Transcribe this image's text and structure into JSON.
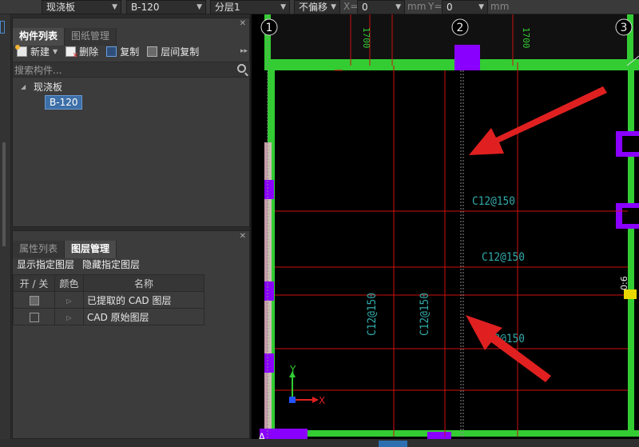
{
  "toolbar": {
    "type_combo": "现浇板",
    "name_combo": "B-120",
    "layer_combo": "分层1",
    "offset_combo": "不偏移",
    "x_label": "X=",
    "x_value": "0",
    "x_unit": "mm",
    "y_label": "Y=",
    "y_value": "0",
    "y_unit": "mm"
  },
  "component_panel": {
    "tabs": [
      "构件列表",
      "图纸管理"
    ],
    "buttons": {
      "new": "新建",
      "delete": "删除",
      "copy": "复制",
      "layer_copy": "层间复制"
    },
    "search_placeholder": "搜索构件...",
    "tree": {
      "parent": "现浇板",
      "child": "B-120"
    }
  },
  "layer_panel": {
    "tabs": [
      "属性列表",
      "图层管理"
    ],
    "buttons": {
      "show": "显示指定图层",
      "hide": "隐藏指定图层"
    },
    "columns": [
      "开 / 关",
      "颜色",
      "名称"
    ],
    "rows": [
      {
        "checked": true,
        "name": "已提取的 CAD 图层"
      },
      {
        "checked": false,
        "name": "CAD 原始图层"
      }
    ]
  },
  "drawing": {
    "axis_labels": [
      "1",
      "2",
      "3"
    ],
    "dimensions": [
      "1700",
      "1700"
    ],
    "rebar_labels": [
      "C12@150",
      "C12@150",
      "C12@150",
      "C12@150",
      "C12@150"
    ],
    "side_label": "0:6",
    "bottom_label": "A",
    "ucs_x": "X",
    "ucs_y": "Y"
  },
  "colors": {
    "wall": "#33cc33",
    "column": "#8a00ff",
    "rebar_line": "#cc1111",
    "rebar_text": "#33aaaa",
    "annotation_arrow": "#e02020",
    "accent": "#3d6fa8"
  }
}
